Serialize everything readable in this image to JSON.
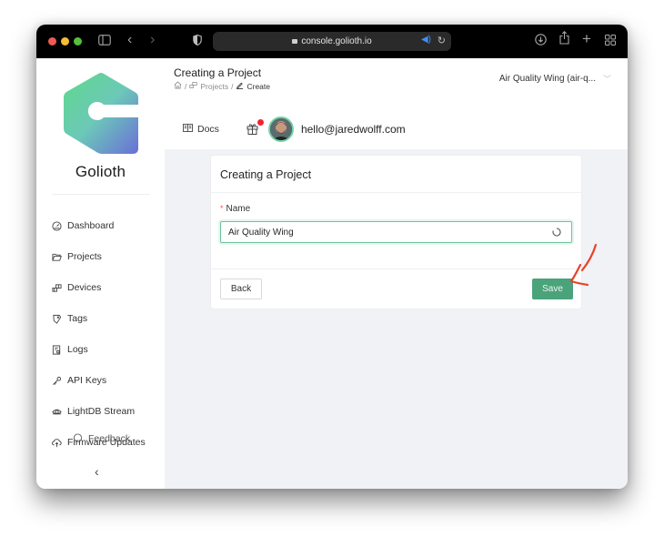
{
  "browser": {
    "url": "console.golioth.io",
    "colors": {
      "traffic_red": "#ee5b53",
      "traffic_yellow": "#f5bd33",
      "traffic_green": "#54c03e"
    }
  },
  "sidebar": {
    "brand": "Golioth",
    "items": [
      {
        "label": "Dashboard",
        "icon": "dashboard-icon"
      },
      {
        "label": "Projects",
        "icon": "folder-icon"
      },
      {
        "label": "Devices",
        "icon": "devices-icon"
      },
      {
        "label": "Tags",
        "icon": "tag-icon"
      },
      {
        "label": "Logs",
        "icon": "logs-icon"
      },
      {
        "label": "API Keys",
        "icon": "key-icon"
      },
      {
        "label": "LightDB Stream",
        "icon": "stream-icon"
      },
      {
        "label": "Firmware Updates",
        "icon": "cloud-upload-icon"
      }
    ],
    "feedback_label": "Feedback",
    "collapse_icon": "chevron-left-icon"
  },
  "header": {
    "title": "Creating a Project",
    "breadcrumb": [
      {
        "label": "",
        "icon": "home-icon"
      },
      {
        "label": "Projects",
        "icon": "devices-icon"
      },
      {
        "label": "Create",
        "icon": "edit-icon"
      }
    ],
    "breadcrumb_separator": "/",
    "project_selector": "Air Quality Wing (air-q...",
    "docs_label": "Docs",
    "user_email": "hello@jaredwolff.com"
  },
  "form": {
    "card_title": "Creating a Project",
    "name_label": "Name",
    "required_mark": "*",
    "name_value": "Air Quality Wing",
    "back_label": "Back",
    "save_label": "Save"
  },
  "colors": {
    "accent": "#4ba37b",
    "input_focus_border": "#6cc49a",
    "notification_dot": "#f5222d",
    "annotation_arrow": "#e8442a",
    "content_bg": "#f0f2f5"
  }
}
